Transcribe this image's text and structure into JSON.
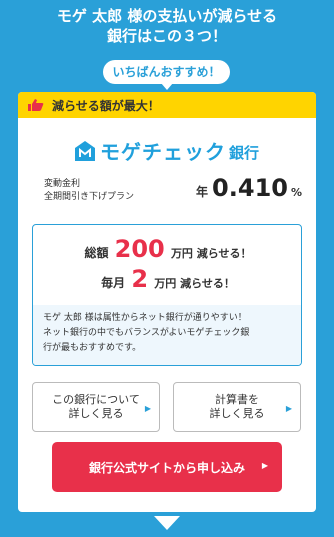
{
  "headline": {
    "line1": "モゲ 太郎 様の支払いが減らせる",
    "line2": "銀行はこの３つ！"
  },
  "recommend_label": "いちばんおすすめ！",
  "banner": {
    "icon": "thumbs-up-icon",
    "text": "減らせる額が最大！",
    "color": "#ffd400"
  },
  "bank": {
    "name": "モゲチェック",
    "suffix": "銀行",
    "logo_icon": "bank-logo-icon"
  },
  "plan": {
    "line1": "変動金利",
    "line2": "全期間引き下げプラン"
  },
  "rate": {
    "prefix": "年",
    "value": "0.410",
    "unit": "%"
  },
  "savings": {
    "total_label": "総額",
    "total_value": "200",
    "total_suffix": "万円 減らせる！",
    "monthly_label": "毎月",
    "monthly_value": "2",
    "monthly_suffix": "万円 減らせる！",
    "note_line1": "モゲ 太郎 様は属性からネット銀行が通りやすい！",
    "note_line2": "ネット銀行の中でもバランスがよいモゲチェック銀",
    "note_line3": "行が最もおすすめです。"
  },
  "buttons": {
    "bank_info_line1": "この銀行について",
    "bank_info_line2": "詳しく見る",
    "calc_line1": "計算書を",
    "calc_line2": "詳しく見る",
    "cta": "銀行公式サイトから申し込み"
  },
  "colors": {
    "background": "#2aa0d8",
    "accent_red": "#e8304a",
    "brand_blue": "#20a0dc"
  }
}
